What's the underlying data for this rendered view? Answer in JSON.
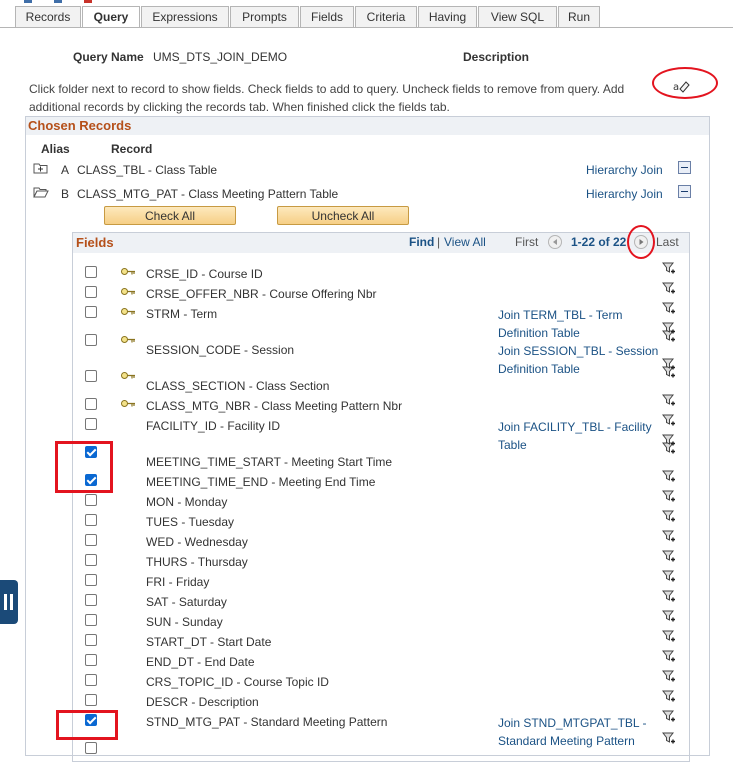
{
  "tabs": [
    "Records",
    "Query",
    "Expressions",
    "Prompts",
    "Fields",
    "Criteria",
    "Having",
    "View SQL",
    "Run"
  ],
  "query": {
    "name_label": "Query Name",
    "name_value": "UMS_DTS_JOIN_DEMO",
    "desc_label": "Description"
  },
  "instructions": "Click folder next to record to show fields. Check fields to add to query. Uncheck fields to remove from query. Add additional records by clicking the records tab. When finished click the fields tab.",
  "chosen": {
    "title": "Chosen Records",
    "col_alias": "Alias",
    "col_record": "Record",
    "records": [
      {
        "alias": "A",
        "name": "CLASS_TBL - Class Table",
        "join": "Hierarchy Join"
      },
      {
        "alias": "B",
        "name": "CLASS_MTG_PAT - Class Meeting Pattern Table",
        "join": "Hierarchy Join"
      }
    ],
    "check_all": "Check All",
    "uncheck_all": "Uncheck All"
  },
  "fields_panel": {
    "title": "Fields",
    "find": "Find",
    "sep": "|",
    "view_all": "View All",
    "first": "First",
    "range": "1-22 of 22",
    "last": "Last"
  },
  "fields": [
    {
      "name": "CRSE_ID - Course ID",
      "checked": false,
      "key": true,
      "join": ""
    },
    {
      "name": "CRSE_OFFER_NBR - Course Offering Nbr",
      "checked": false,
      "key": true,
      "join": ""
    },
    {
      "name": "STRM - Term",
      "checked": false,
      "key": true,
      "join": "Join TERM_TBL - Term Definition Table"
    },
    {
      "name": "SESSION_CODE - Session",
      "checked": false,
      "key": true,
      "join": "Join SESSION_TBL - Session Definition Table"
    },
    {
      "name": "CLASS_SECTION - Class Section",
      "checked": false,
      "key": true,
      "join": ""
    },
    {
      "name": "CLASS_MTG_NBR - Class Meeting Pattern Nbr",
      "checked": false,
      "key": true,
      "join": ""
    },
    {
      "name": "FACILITY_ID - Facility ID",
      "checked": false,
      "key": false,
      "join": "Join FACILITY_TBL - Facility Table"
    },
    {
      "name": "MEETING_TIME_START - Meeting Start Time",
      "checked": true,
      "key": false,
      "join": ""
    },
    {
      "name": "MEETING_TIME_END - Meeting End Time",
      "checked": true,
      "key": false,
      "join": ""
    },
    {
      "name": "MON - Monday",
      "checked": false,
      "key": false,
      "join": ""
    },
    {
      "name": "TUES - Tuesday",
      "checked": false,
      "key": false,
      "join": ""
    },
    {
      "name": "WED - Wednesday",
      "checked": false,
      "key": false,
      "join": ""
    },
    {
      "name": "THURS - Thursday",
      "checked": false,
      "key": false,
      "join": ""
    },
    {
      "name": "FRI - Friday",
      "checked": false,
      "key": false,
      "join": ""
    },
    {
      "name": "SAT - Saturday",
      "checked": false,
      "key": false,
      "join": ""
    },
    {
      "name": "SUN - Sunday",
      "checked": false,
      "key": false,
      "join": ""
    },
    {
      "name": "START_DT - Start Date",
      "checked": false,
      "key": false,
      "join": ""
    },
    {
      "name": "END_DT - End Date",
      "checked": false,
      "key": false,
      "join": ""
    },
    {
      "name": "CRS_TOPIC_ID - Course Topic ID",
      "checked": false,
      "key": false,
      "join": ""
    },
    {
      "name": "DESCR - Description",
      "checked": false,
      "key": false,
      "join": ""
    },
    {
      "name": "STND_MTG_PAT - Standard Meeting Pattern",
      "checked": true,
      "key": false,
      "join": "Join STND_MTGPAT_TBL - Standard Meeting Pattern"
    },
    {
      "name": "",
      "checked": false,
      "key": false,
      "join": ""
    }
  ],
  "colors": {
    "accent": "#b5501a",
    "link": "#1b5285",
    "highlight": "#e3141f",
    "check": "#0a68d2"
  }
}
